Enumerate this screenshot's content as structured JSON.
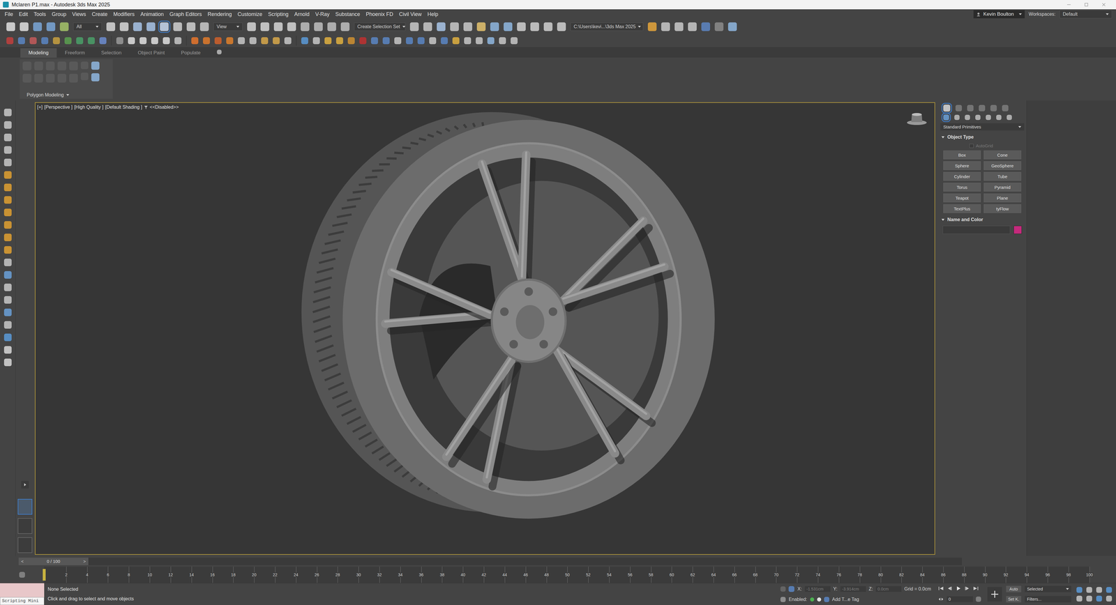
{
  "window": {
    "title": "Mclaren P1.max - Autodesk 3ds Max 2025"
  },
  "menu": [
    "File",
    "Edit",
    "Tools",
    "Group",
    "Views",
    "Create",
    "Modifiers",
    "Animation",
    "Graph Editors",
    "Rendering",
    "Customize",
    "Scripting",
    "Arnold",
    "V-Ray",
    "Substance",
    "Phoenix FD",
    "Civil View",
    "Help"
  ],
  "user": {
    "name": "Kevin Boulton",
    "workspaces_label": "Workspaces:",
    "workspace": "Default"
  },
  "main_toolbar": {
    "filter": "All",
    "reference": "View",
    "selection_set": "Create Selection Set",
    "project_path": "C:\\Users\\kevi...\\3ds Max 2025"
  },
  "ribbon": {
    "tabs": [
      {
        "label": "Modeling",
        "selected": true
      },
      {
        "label": "Freeform",
        "selected": false
      },
      {
        "label": "Selection",
        "selected": false
      },
      {
        "label": "Object Paint",
        "selected": false
      },
      {
        "label": "Populate",
        "selected": false
      }
    ],
    "panel": "Polygon Modeling"
  },
  "viewport": {
    "labels": [
      "[+]",
      "[Perspective ]",
      "[High Quality ]",
      "[Default Shading ]"
    ],
    "filter": "<<Disabled>>",
    "active": true
  },
  "command_panel": {
    "category": "Standard Primitives",
    "object_type": {
      "title": "Object Type",
      "autogrid": {
        "label": "AutoGrid",
        "checked": false,
        "disabled": true
      },
      "buttons": [
        "Box",
        "Cone",
        "Sphere",
        "GeoSphere",
        "Cylinder",
        "Tube",
        "Torus",
        "Pyramid",
        "Teapot",
        "Plane",
        "TextPlus",
        "tyFlow"
      ]
    },
    "name_and_color": {
      "title": "Name and Color",
      "color": "#c42a7c"
    }
  },
  "time_slider": {
    "prev": "<",
    "position": "0 / 100",
    "next": ">",
    "level": 0
  },
  "track_bar": {
    "ticks": [
      "2",
      "4",
      "6",
      "8",
      "10",
      "12",
      "14",
      "16",
      "18",
      "20",
      "22",
      "24",
      "26",
      "28",
      "30",
      "32",
      "34",
      "36",
      "38",
      "40",
      "42",
      "44",
      "46",
      "48",
      "50",
      "52",
      "54",
      "56",
      "58",
      "60",
      "62",
      "64",
      "66",
      "68",
      "70",
      "72",
      "74",
      "76",
      "78",
      "80",
      "82",
      "84",
      "86",
      "88",
      "90",
      "92",
      "94",
      "96",
      "98",
      "100"
    ]
  },
  "status": {
    "listener_label": "Scripting Mini",
    "selection": "None Selected",
    "prompt": "Click and drag to select and move objects",
    "coords": [
      {
        "axis": "X:",
        "value": "-1.531cm"
      },
      {
        "axis": "Y:",
        "value": "-3.914cm"
      },
      {
        "axis": "Z:",
        "value": "0.0cm"
      }
    ],
    "grid": "Grid = 0.0cm",
    "enabled_label": "Enabled:",
    "tag": "Add T...e Tag",
    "frame": "0",
    "auto_key": "Auto",
    "set_key": "Set K.",
    "key_filter": "Selected",
    "filters": "Filters..."
  }
}
